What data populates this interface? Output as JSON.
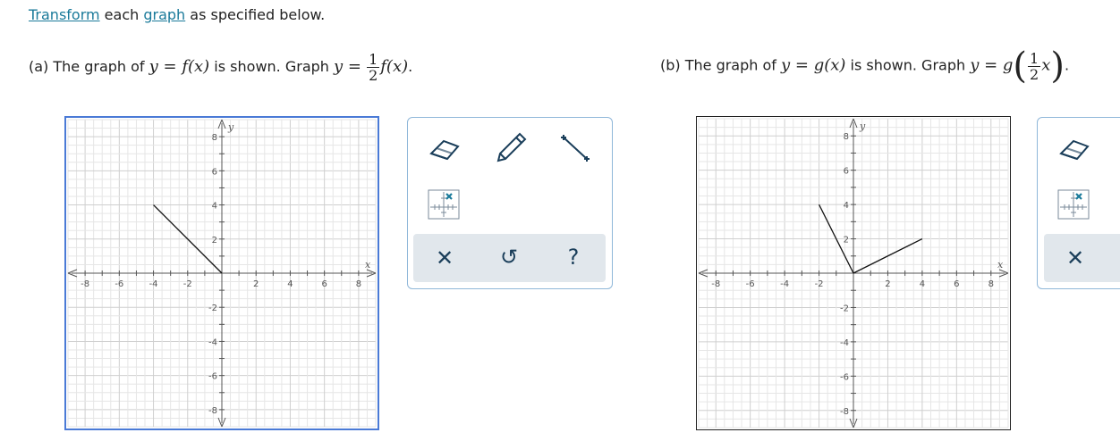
{
  "instruction": {
    "link1": "Transform",
    "mid": " each ",
    "link2": "graph",
    "end": " as specified below."
  },
  "part_a": {
    "label": "(a)  The graph of ",
    "given": "y = f(x)",
    "mid": " is shown. Graph ",
    "target_lhs": "y =",
    "frac_num": "1",
    "frac_den": "2",
    "target_rhs": "f(x)",
    "end": "."
  },
  "part_b": {
    "label": "(b)  The graph of ",
    "given": "y = g(x)",
    "mid": " is shown. Graph ",
    "target_lhs": "y = g",
    "frac_num": "1",
    "frac_den": "2",
    "target_rhs": "x",
    "end": "."
  },
  "axis": {
    "x_label": "x",
    "y_label": "y",
    "x_ticks": [
      "-8",
      "-6",
      "-4",
      "-2",
      "2",
      "4",
      "6",
      "8"
    ],
    "y_ticks": [
      "8",
      "6",
      "4",
      "2",
      "-2",
      "-4",
      "-6",
      "-8"
    ],
    "range": [
      -9,
      9
    ]
  },
  "graph_a_segments": [
    {
      "x1": -4,
      "y1": 4,
      "x2": 0,
      "y2": 0
    }
  ],
  "graph_b_segments": [
    {
      "x1": -2,
      "y1": 4,
      "x2": 0,
      "y2": 0
    },
    {
      "x1": 0,
      "y1": 0,
      "x2": 4,
      "y2": 2
    }
  ],
  "tools": {
    "eraser": "eraser-icon",
    "pencil": "pencil-icon",
    "segment": "line-segment-icon",
    "graph_tool": "graph-point-icon",
    "clear": "✕",
    "undo": "↺",
    "help": "?"
  },
  "colors": {
    "link": "#1a7a9a",
    "selected_border": "#4a7ad6",
    "grid_minor": "#e6e6e6",
    "grid_major": "#cfcfcf",
    "toolbar_border": "#8fb7d9",
    "ctrl_bg": "#e1e7ec"
  }
}
